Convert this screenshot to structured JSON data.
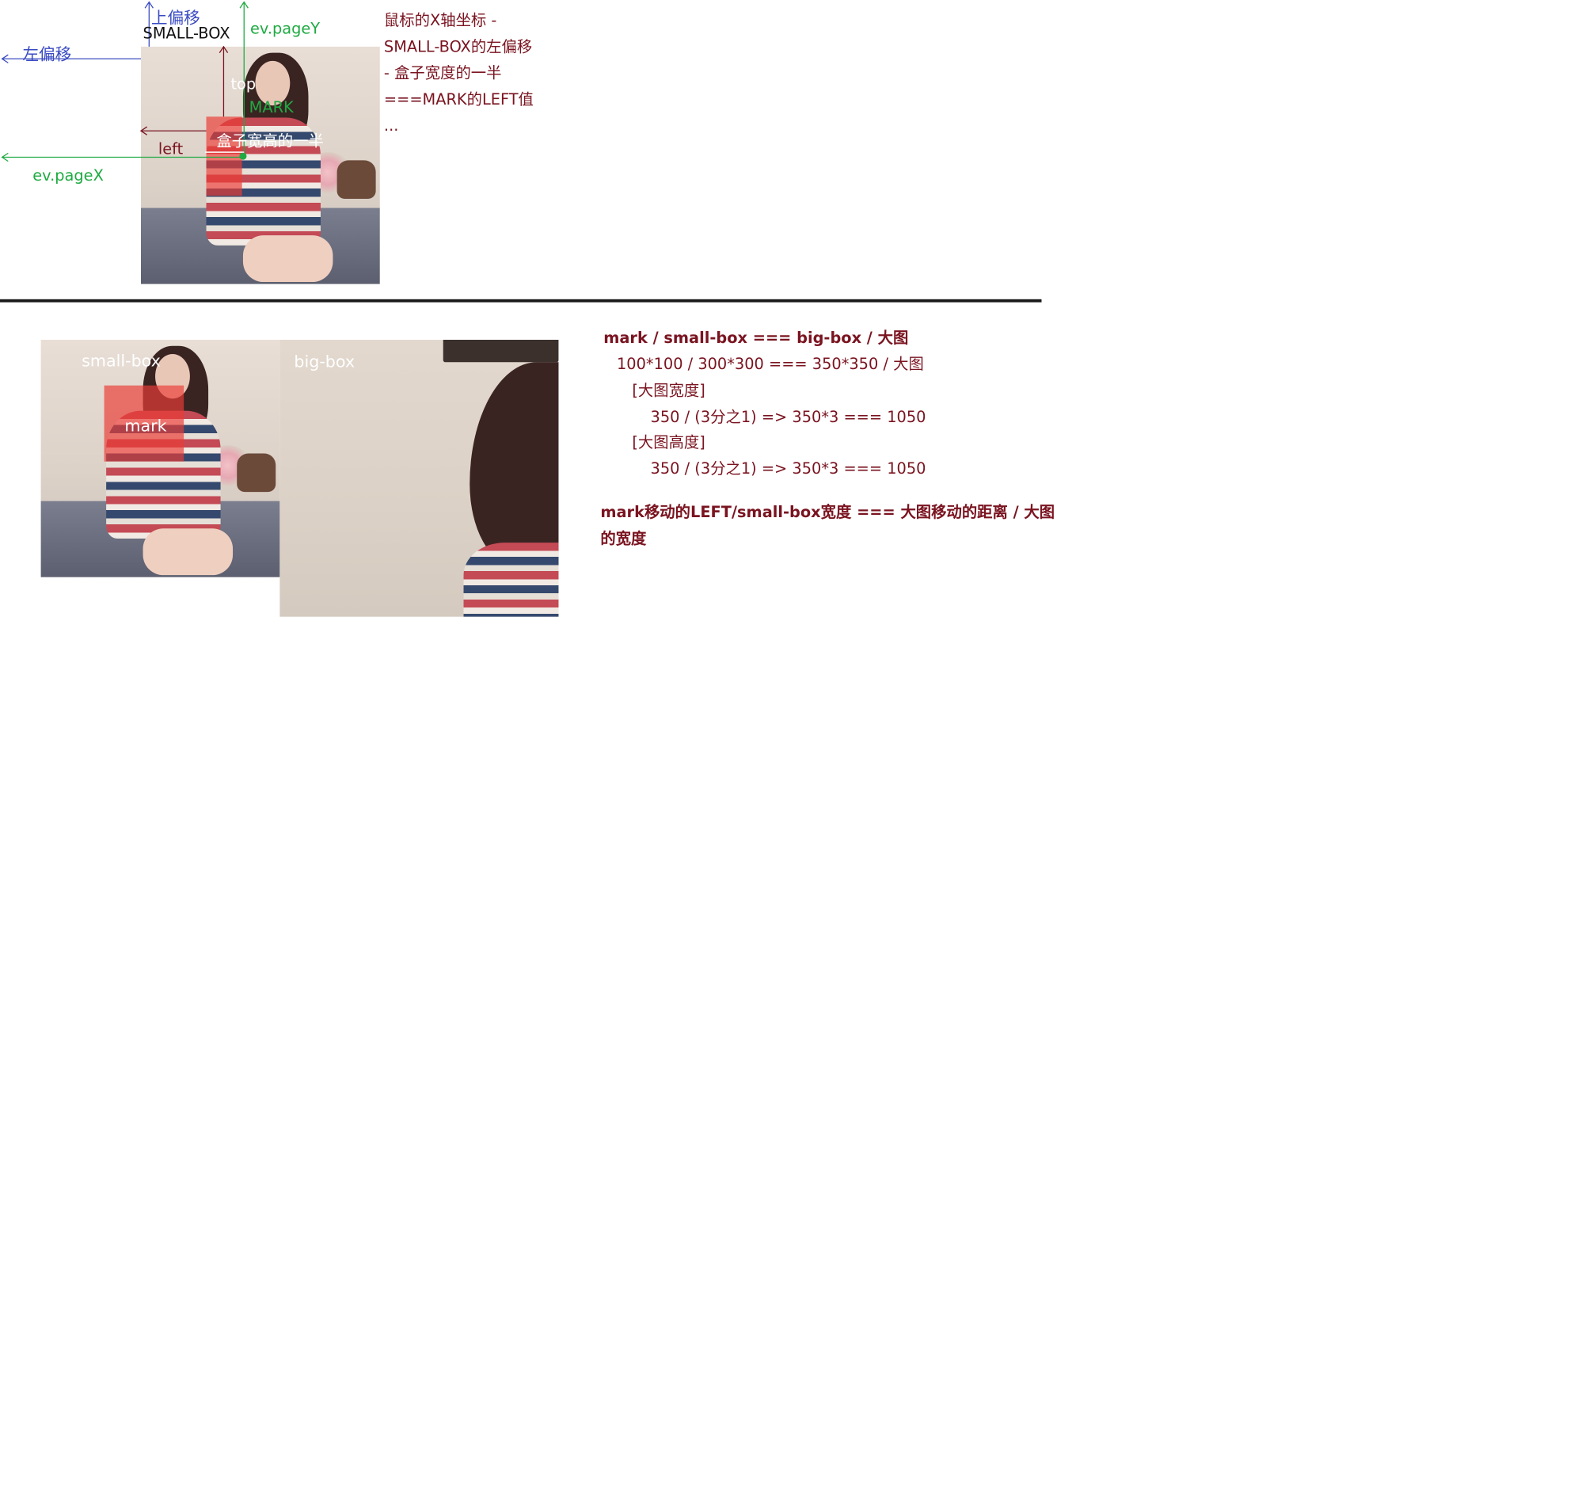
{
  "top": {
    "labels": {
      "top_offset": "上偏移",
      "small_box_upper": "SMALL-BOX",
      "left_offset": "左偏移",
      "page_y": "ev.pageY",
      "page_x": "ev.pageX",
      "top": "top",
      "mark_upper": "MARK",
      "left": "left",
      "half_size": "盒子宽高的一半"
    },
    "formula_lines": [
      "鼠标的X轴坐标 -",
      "SMALL-BOX的左偏移",
      "- 盒子宽度的一半",
      "===MARK的LEFT值",
      "..."
    ]
  },
  "bottom": {
    "small_box_label": "small-box",
    "mark_label": "mark",
    "big_box_label": "big-box",
    "ratio_title": "mark / small-box   === big-box / 大图",
    "ratio_example": "100*100 / 300*300   === 350*350 / 大图",
    "width_heading": "[大图宽度]",
    "width_calc": "350 / (3分之1) => 350*3   === 1050",
    "height_heading": "[大图高度]",
    "height_calc": "350 / (3分之1) => 350*3   === 1050",
    "move_rule_line1": "mark移动的LEFT/small-box宽度 ===  大图移动的距离 / 大图",
    "move_rule_line2": "的宽度"
  },
  "colors": {
    "annotation_red": "#7a1420",
    "offset_blue": "#3a4bc2",
    "event_green": "#1faa42",
    "mark_overlay": "#eb3c37"
  }
}
